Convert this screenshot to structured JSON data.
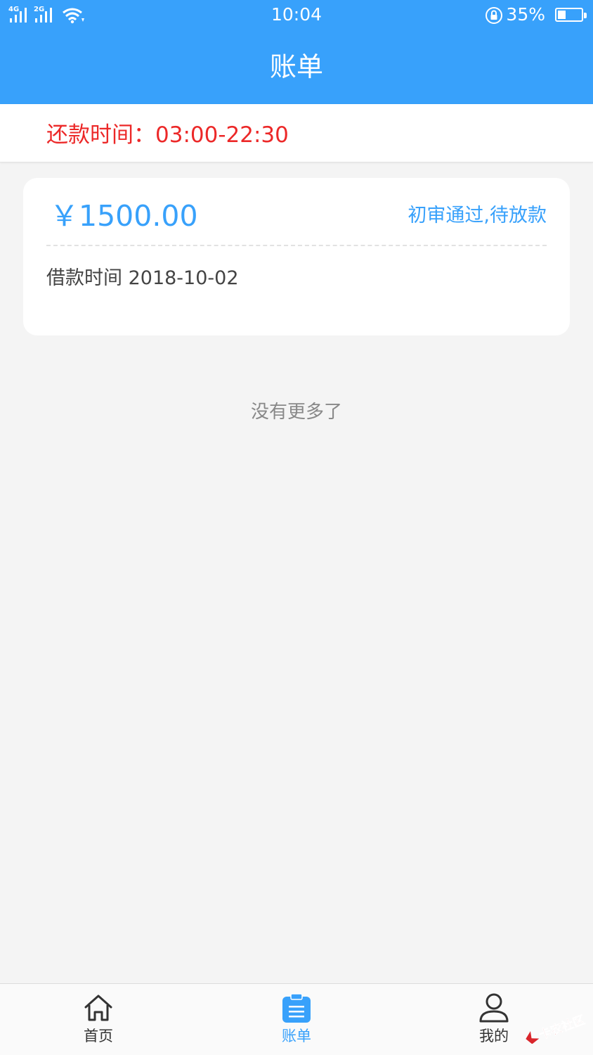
{
  "status_bar": {
    "network_1": "4G",
    "network_2": "2G",
    "time": "10:04",
    "battery": "35%",
    "battery_level": 0.35
  },
  "header": {
    "title": "账单"
  },
  "notice": {
    "repay_time": "还款时间：03:00-22:30"
  },
  "bill": {
    "amount": "￥1500.00",
    "status": "初审通过,待放款",
    "loan_date": "借款时间 2018-10-02"
  },
  "list_end": "没有更多了",
  "tabbar": {
    "items": [
      {
        "label": "首页",
        "icon": "home-icon"
      },
      {
        "label": "账单",
        "icon": "bill-icon",
        "active": true
      },
      {
        "label": "我的",
        "icon": "user-icon"
      }
    ]
  },
  "watermark": "卡农社区",
  "colors": {
    "primary": "#38a1fb",
    "notice_red": "#ec2828",
    "background": "#f4f4f4"
  }
}
